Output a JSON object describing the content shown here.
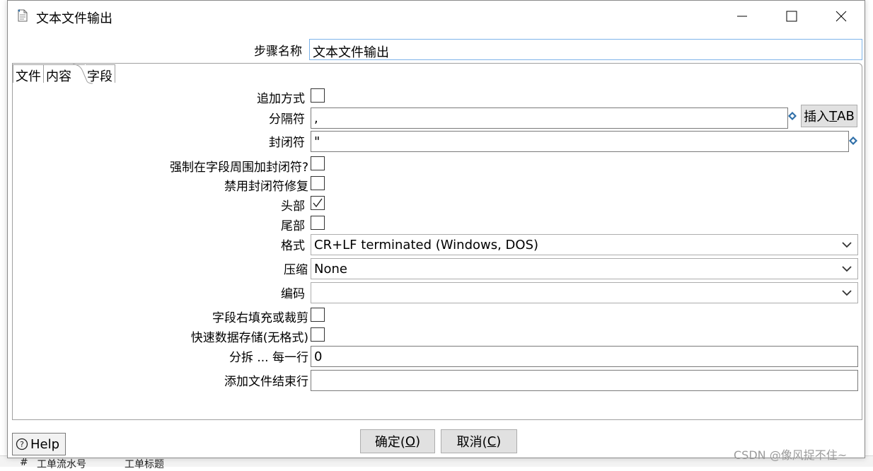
{
  "window": {
    "title": "文本文件输出",
    "buttons": {
      "minimize": "minimize",
      "maximize": "maximize",
      "close": "close"
    }
  },
  "step_name": {
    "label": "步骤名称",
    "value": "文本文件输出"
  },
  "tabs": [
    {
      "label": "文件",
      "active": false
    },
    {
      "label": "内容",
      "active": true
    },
    {
      "label": "字段",
      "active": false
    }
  ],
  "form": {
    "append": {
      "label": "追加方式",
      "checked": false
    },
    "separator": {
      "label": "分隔符",
      "value": ",",
      "insert_tab_label": "插入TAB",
      "insert_tab_prefix": "插入",
      "insert_tab_mnemonic": "T",
      "insert_tab_suffix": "AB"
    },
    "enclosure": {
      "label": "封闭符",
      "value": "\""
    },
    "force_enclosure": {
      "label": "强制在字段周围加封闭符?",
      "checked": false
    },
    "disable_enclosure_fix": {
      "label": "禁用封闭符修复",
      "checked": false
    },
    "header": {
      "label": "头部",
      "checked": true
    },
    "footer": {
      "label": "尾部",
      "checked": false
    },
    "format": {
      "label": "格式",
      "value": "CR+LF terminated (Windows, DOS)"
    },
    "compression": {
      "label": "压缩",
      "value": "None"
    },
    "encoding": {
      "label": "编码",
      "value": ""
    },
    "right_pad": {
      "label": "字段右填充或裁剪",
      "checked": false
    },
    "fast_dump": {
      "label": "快速数据存储(无格式)",
      "checked": false
    },
    "split_every": {
      "label": "分拆 ... 每一行",
      "value": "0"
    },
    "end_line": {
      "label": "添加文件结束行",
      "value": ""
    }
  },
  "footer_buttons": {
    "help": "Help",
    "ok_text": "确定(",
    "ok_key": "O",
    "ok_end": ")",
    "cancel_text": "取消(",
    "cancel_key": "C",
    "cancel_end": ")"
  },
  "background_strip": {
    "col1": "#",
    "col2": "工单流水号",
    "col3": "工单标题"
  },
  "watermark": "CSDN @像风捉不住~",
  "colors": {
    "focus_border": "#7eb4ea",
    "button_bg": "#e1e1e1",
    "diamond": "#2f6fa8"
  }
}
